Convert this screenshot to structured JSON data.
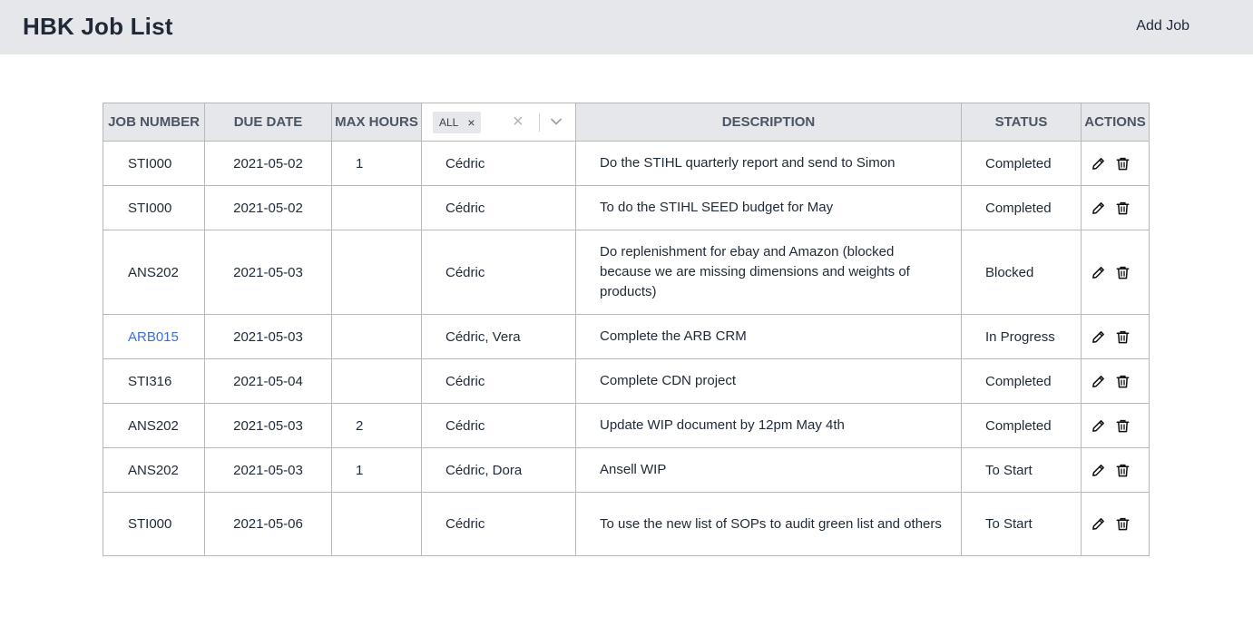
{
  "header": {
    "title": "HBK Job List",
    "add_job_label": "Add Job"
  },
  "table": {
    "columns": {
      "job_number": "JOB NUMBER",
      "due_date": "DUE DATE",
      "max_hours": "MAX HOURS",
      "description": "DESCRIPTION",
      "status": "STATUS",
      "actions": "ACTIONS"
    },
    "assignee_filter": {
      "selected_chip": "ALL",
      "chip_remove_icon": "close-icon",
      "clear_icon": "close-icon",
      "dropdown_icon": "chevron-down-icon"
    },
    "rows": [
      {
        "job": "STI000",
        "date": "2021-05-02",
        "hours": "1",
        "assignee": "Cédric",
        "desc": "Do the STIHL quarterly report and send to Simon",
        "status": "Completed"
      },
      {
        "job": "STI000",
        "date": "2021-05-02",
        "hours": "",
        "assignee": "Cédric",
        "desc": "To do the STIHL SEED budget for May",
        "status": "Completed"
      },
      {
        "job": "ANS202",
        "date": "2021-05-03",
        "hours": "",
        "assignee": "Cédric",
        "desc": "Do replenishment for ebay and Amazon (blocked because we are missing dimensions and weights of products)",
        "status": "Blocked"
      },
      {
        "job": "ARB015",
        "date": "2021-05-03",
        "hours": "",
        "assignee": "Cédric, Vera",
        "desc": "Complete the ARB CRM",
        "status": "In Progress"
      },
      {
        "job": "STI316",
        "date": "2021-05-04",
        "hours": "",
        "assignee": "Cédric",
        "desc": "Complete CDN project",
        "status": "Completed"
      },
      {
        "job": "ANS202",
        "date": "2021-05-03",
        "hours": "2",
        "assignee": "Cédric",
        "desc": "Update WIP document by 12pm May 4th",
        "status": "Completed"
      },
      {
        "job": "ANS202",
        "date": "2021-05-03",
        "hours": "1",
        "assignee": "Cédric, Dora",
        "desc": "Ansell WIP",
        "status": "To Start"
      },
      {
        "job": "STI000",
        "date": "2021-05-06",
        "hours": "",
        "assignee": "Cédric",
        "desc": "To use the new list of SOPs to audit green list and others",
        "status": "To Start"
      }
    ],
    "action_icons": [
      "pencil-icon",
      "trash-icon"
    ]
  },
  "colors": {
    "header_bg": "#e5e7eb",
    "link": "#3b6fd4",
    "border": "#b8b8b8"
  }
}
